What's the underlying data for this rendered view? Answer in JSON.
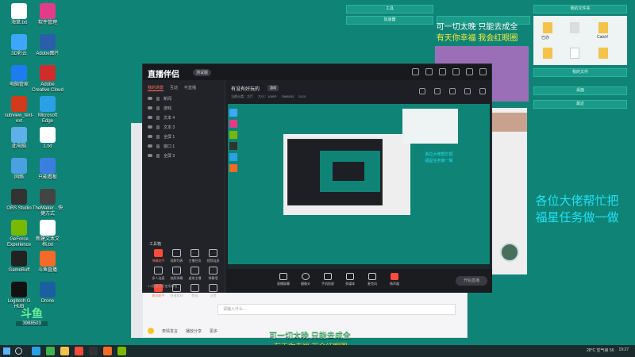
{
  "desktop_icons": [
    {
      "label": "海草.txt",
      "color": "#ffffff"
    },
    {
      "label": "软件管理",
      "color": "#e23b8a"
    },
    {
      "label": "3D彩云",
      "color": "#3fa6ff"
    },
    {
      "label": "Adobe图片",
      "color": "#2b5eaa"
    },
    {
      "label": "电脑管家",
      "color": "#1e7cf0"
    },
    {
      "label": "Adobe Creative Cloud",
      "color": "#d12c2c"
    },
    {
      "label": "subview_text-ext",
      "color": "#d23a1c"
    },
    {
      "label": "Microsoft Edge",
      "color": "#2aa1e6"
    },
    {
      "label": "此电脑",
      "color": "#5fb0e8"
    },
    {
      "label": "1.txt",
      "color": "#ffffff"
    },
    {
      "label": "网络",
      "color": "#4aa0e0"
    },
    {
      "label": "只能看板",
      "color": "#3a7fe0"
    },
    {
      "label": "OBS Studio",
      "color": "#333333"
    },
    {
      "label": "TheMaker - 快捷方式",
      "color": "#444444"
    },
    {
      "label": "GeForce Experience",
      "color": "#76b900"
    },
    {
      "label": "新建文本文档.txt",
      "color": "#ffffff"
    },
    {
      "label": "GameBuff",
      "color": "#222222"
    },
    {
      "label": "斗鱼直播",
      "color": "#f46a29"
    },
    {
      "label": "Logitech G HUB",
      "color": "#111111"
    },
    {
      "label": "Drone",
      "color": "#1c5fa0"
    }
  ],
  "right_panel": {
    "buttons": [
      "工具",
      "加速器",
      "我的文件夹",
      "我的文件",
      "桌面",
      "最近"
    ],
    "overlay_text_top": [
      "可一切太晚 只能去成全",
      "有天你幸福 我会红眼圈"
    ],
    "overlay_text_right": [
      "各位大佬帮忙把",
      "福星任务做一做"
    ],
    "folder_labels": [
      "已办",
      "Catch!"
    ]
  },
  "app": {
    "logo": "直播伴侣",
    "version_badge": "测试版",
    "left_tabs": [
      "我的场景",
      "互动",
      "可直播"
    ],
    "scenes": [
      "新闻",
      "游戏",
      "文本 4",
      "文本 3",
      "全屏 1",
      "窗口 1",
      "全屏 3"
    ],
    "tools_title": "工具箱",
    "tools": [
      "弹幕助手",
      "观察列表",
      "主播任务",
      "视频连麦",
      "多人连麦",
      "抽奖弹幕",
      "虚拟主播",
      "弹幕墙",
      "歌词助手",
      "直播素材",
      "数据",
      "设置"
    ],
    "footer_text": "3.8直播伴侣使用教程",
    "room_title": "有没有好玩的",
    "room_badge": "游戏",
    "room_meta": [
      "当前分类：大厅",
      "大小：1080P",
      "2968503",
      "2420"
    ],
    "bottom_tools": [
      "直播屏幕",
      "摄像头",
      "手机投屏",
      "多媒体",
      "麦克风",
      "扬声器"
    ],
    "start_label": "开始直播"
  },
  "chat": {
    "input_placeholder": "请输入什么...",
    "tool_labels": [
      "表情发言",
      "播放分享",
      "更多"
    ],
    "room_number": "3988503",
    "platform_label": "斗鱼"
  },
  "captions": [
    "可一切太晚 只能去成全",
    "有天你幸福 我会红眼圈"
  ],
  "taskbar": {
    "weather": "28°C 空气良 56",
    "time": "19:27"
  }
}
